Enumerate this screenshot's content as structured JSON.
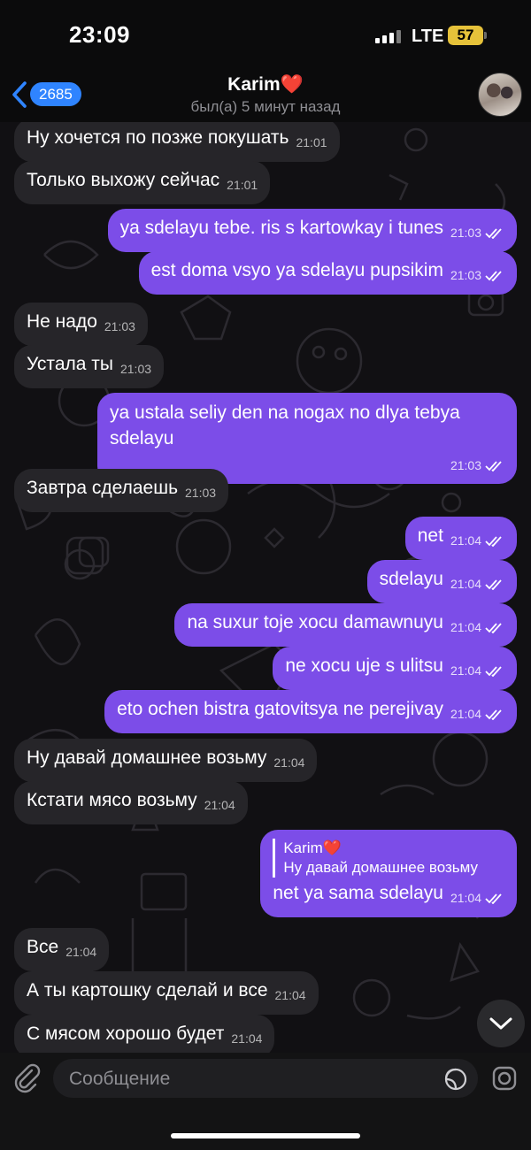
{
  "status_bar": {
    "time": "23:09",
    "network": "LTE",
    "battery": "57"
  },
  "header": {
    "unread_count": "2685",
    "title": "Karim",
    "title_emoji": "❤️",
    "subtitle": "был(а) 5 минут назад"
  },
  "messages": [
    {
      "direction": "incoming",
      "text": "Ну хочется по позже покушать",
      "time": "21:01"
    },
    {
      "direction": "incoming",
      "text": "Только выхожу сейчас",
      "time": "21:01"
    },
    {
      "direction": "outgoing",
      "text": "ya  sdelayu tebe. ris s kartowkay i tunes",
      "time": "21:03",
      "read": true
    },
    {
      "direction": "outgoing",
      "text": "est doma vsyo ya sdelayu pupsikim",
      "time": "21:03",
      "read": true
    },
    {
      "direction": "incoming",
      "text": "Не надо",
      "time": "21:03"
    },
    {
      "direction": "incoming",
      "text": "Устала ты",
      "time": "21:03"
    },
    {
      "direction": "outgoing",
      "text": "ya ustala seliy den na nogax no dlya tebya sdelayu",
      "time": "21:03",
      "read": true
    },
    {
      "direction": "incoming",
      "text": "Завтра сделаешь",
      "time": "21:03"
    },
    {
      "direction": "outgoing",
      "text": "net",
      "time": "21:04",
      "read": true
    },
    {
      "direction": "outgoing",
      "text": "sdelayu",
      "time": "21:04",
      "read": true
    },
    {
      "direction": "outgoing",
      "text": "na suxur toje xocu damawnuyu",
      "time": "21:04",
      "read": true
    },
    {
      "direction": "outgoing",
      "text": "ne xocu uje s ulitsu",
      "time": "21:04",
      "read": true
    },
    {
      "direction": "outgoing",
      "text": "eto ochen bistra gatovitsya ne perejivay",
      "time": "21:04",
      "read": true
    },
    {
      "direction": "incoming",
      "text": "Ну давай домашнее возьму",
      "time": "21:04"
    },
    {
      "direction": "incoming",
      "text": "Кстати мясо возьму",
      "time": "21:04"
    },
    {
      "direction": "outgoing",
      "reply_to_name": "Karim❤️",
      "reply_to_text": "Ну давай домашнее возьму",
      "text": "net ya sama sdelayu",
      "time": "21:04",
      "read": true
    },
    {
      "direction": "incoming",
      "text": "Все",
      "time": "21:04"
    },
    {
      "direction": "incoming",
      "text": "А ты картошку сделай и все",
      "time": "21:04"
    },
    {
      "direction": "incoming",
      "text": "С мясом хорошо будет",
      "time": "21:04"
    }
  ],
  "input": {
    "placeholder": "Сообщение"
  },
  "icons": {
    "back": "chevron-left-icon",
    "attach": "paperclip-icon",
    "sticker": "sticker-icon",
    "camera": "camera-icon",
    "scroll_down": "chevron-down-icon",
    "read_receipt": "double-check-icon"
  },
  "colors": {
    "outgoing_bubble": "#7c4de8",
    "incoming_bubble": "#262529",
    "badge": "#2f84ff",
    "battery": "#e6c23a",
    "heart": "#e32f3a"
  }
}
